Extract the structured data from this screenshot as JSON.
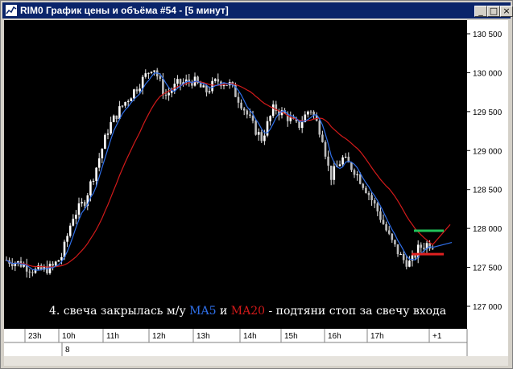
{
  "window": {
    "title": "RIM0 График цены и объёма #54 - [5 минут]",
    "buttons": {
      "minimize": "_",
      "maximize": "□",
      "close": "×"
    }
  },
  "annotation": {
    "prefix": "4. свеча закрылась м/у ",
    "ma5": "MA5",
    "and": " и ",
    "ma20": "MA20",
    "suffix": " - подтяни стоп за свечу входа"
  },
  "colors": {
    "background": "#000000",
    "candle": "#e6e6e6",
    "ma5": "#2f6fe8",
    "ma20": "#d21a1a",
    "target_line": "#22c25a",
    "stop_line": "#e02020",
    "title_bar": "#0a246a"
  },
  "chart_data": {
    "type": "candlestick",
    "y_axis_labels": [
      "130 500",
      "130 000",
      "129 500",
      "129 000",
      "128 500",
      "128 000",
      "127 500",
      "127 000"
    ],
    "y_axis_values": [
      130500,
      130000,
      129500,
      129000,
      128500,
      128000,
      127500,
      127000
    ],
    "time_labels": [
      "23h",
      "10h",
      "11h",
      "12h",
      "13h",
      "14h",
      "15h",
      "16h",
      "17h",
      "+1"
    ],
    "date_labels": [
      "8"
    ],
    "ylim": [
      126950,
      130550
    ],
    "series": [
      {
        "name": "MA5",
        "color": "#2f6fe8"
      },
      {
        "name": "MA20",
        "color": "#d21a1a"
      }
    ],
    "levels": {
      "target": 127970,
      "stop": 127670
    }
  }
}
